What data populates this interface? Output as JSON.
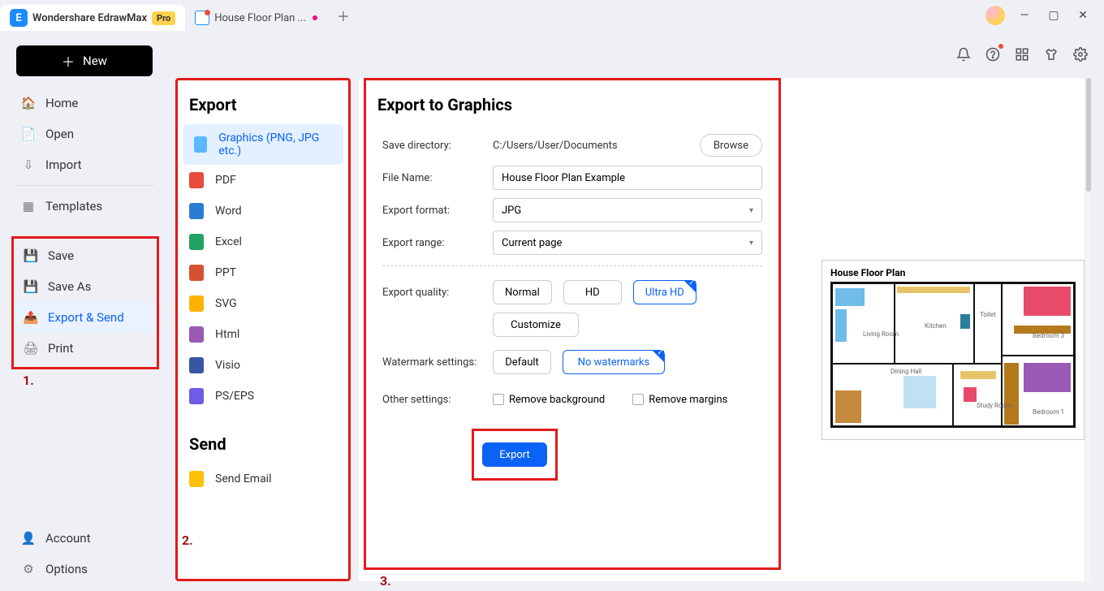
{
  "titlebar": {
    "app_tab": "Wondershare EdrawMax",
    "pro": "Pro",
    "doc_tab": "House Floor Plan ..."
  },
  "new_button": "New",
  "nav_main": {
    "home": "Home",
    "open": "Open",
    "import": "Import",
    "templates": "Templates"
  },
  "nav_file": {
    "save": "Save",
    "save_as": "Save As",
    "export_send": "Export & Send",
    "print": "Print"
  },
  "nav_bottom": {
    "account": "Account",
    "options": "Options"
  },
  "annot": {
    "one": "1.",
    "two": "2.",
    "three": "3."
  },
  "export_panel": {
    "title": "Export",
    "formats": {
      "graphics": "Graphics (PNG, JPG etc.)",
      "pdf": "PDF",
      "word": "Word",
      "excel": "Excel",
      "ppt": "PPT",
      "svg": "SVG",
      "html": "Html",
      "visio": "Visio",
      "pseps": "PS/EPS"
    },
    "send_title": "Send",
    "send_email": "Send Email"
  },
  "form": {
    "title": "Export to Graphics",
    "save_dir_lbl": "Save directory:",
    "save_dir_val": "C:/Users/User/Documents",
    "browse": "Browse",
    "file_name_lbl": "File Name:",
    "file_name_val": "House Floor Plan Example",
    "format_lbl": "Export format:",
    "format_val": "JPG",
    "range_lbl": "Export range:",
    "range_val": "Current page",
    "quality_lbl": "Export quality:",
    "quality_opts": {
      "normal": "Normal",
      "hd": "HD",
      "uhd": "Ultra HD"
    },
    "customize": "Customize",
    "watermark_lbl": "Watermark settings:",
    "watermark_opts": {
      "default": "Default",
      "none": "No watermarks"
    },
    "other_lbl": "Other settings:",
    "remove_bg": "Remove background",
    "remove_margins": "Remove margins",
    "export_btn": "Export"
  },
  "preview": {
    "title": "House Floor Plan",
    "rooms": {
      "living": "Living Room",
      "kitchen": "Kitchen",
      "toilet": "Toilet",
      "dining": "Dining Hall",
      "study": "Study Room",
      "bed3": "Bedroom 3",
      "bed1": "Bedroom 1"
    }
  }
}
